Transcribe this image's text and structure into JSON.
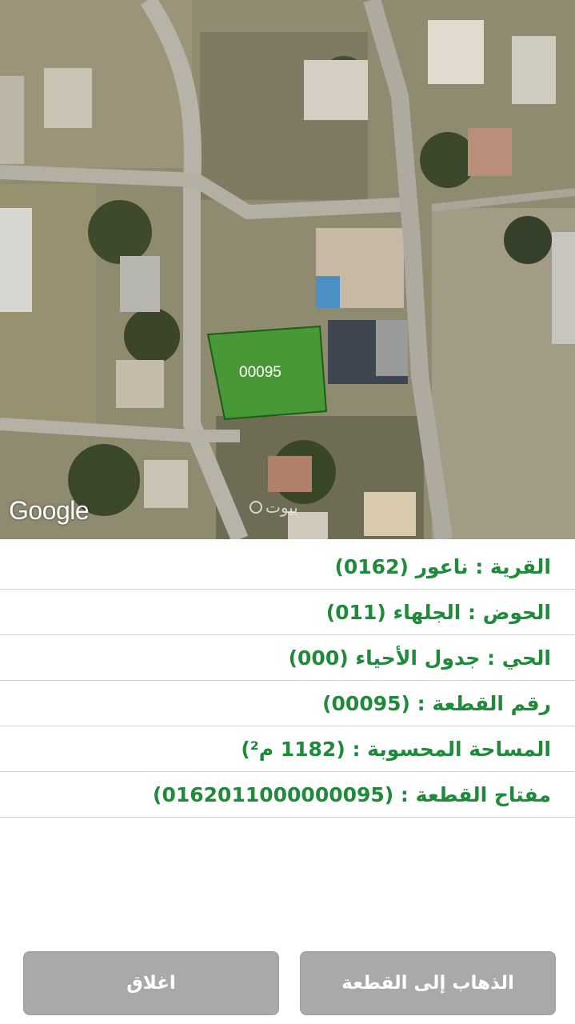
{
  "map": {
    "provider_logo": "Google",
    "watermark_text": "بيوت",
    "watermark_icon": "search-icon",
    "parcel": {
      "label": "00095",
      "fill_color": "#3f9a2e"
    }
  },
  "info": {
    "rows": [
      {
        "text": "القرية : ناعور (0162)"
      },
      {
        "text": "الحوض : الجلهاء (011)"
      },
      {
        "text": "الحي : جدول الأحياء (000)"
      },
      {
        "text": "رقم القطعة : (00095)"
      },
      {
        "text": "المساحة المحسوبة : (1182 م²)"
      },
      {
        "text": "مفتاح القطعة : (0162011000000095)"
      }
    ],
    "text_color": "#1f8a3a"
  },
  "buttons": {
    "goto_label": "الذهاب إلى القطعة",
    "close_label": "اغلاق",
    "background": "#a9a9a9"
  }
}
